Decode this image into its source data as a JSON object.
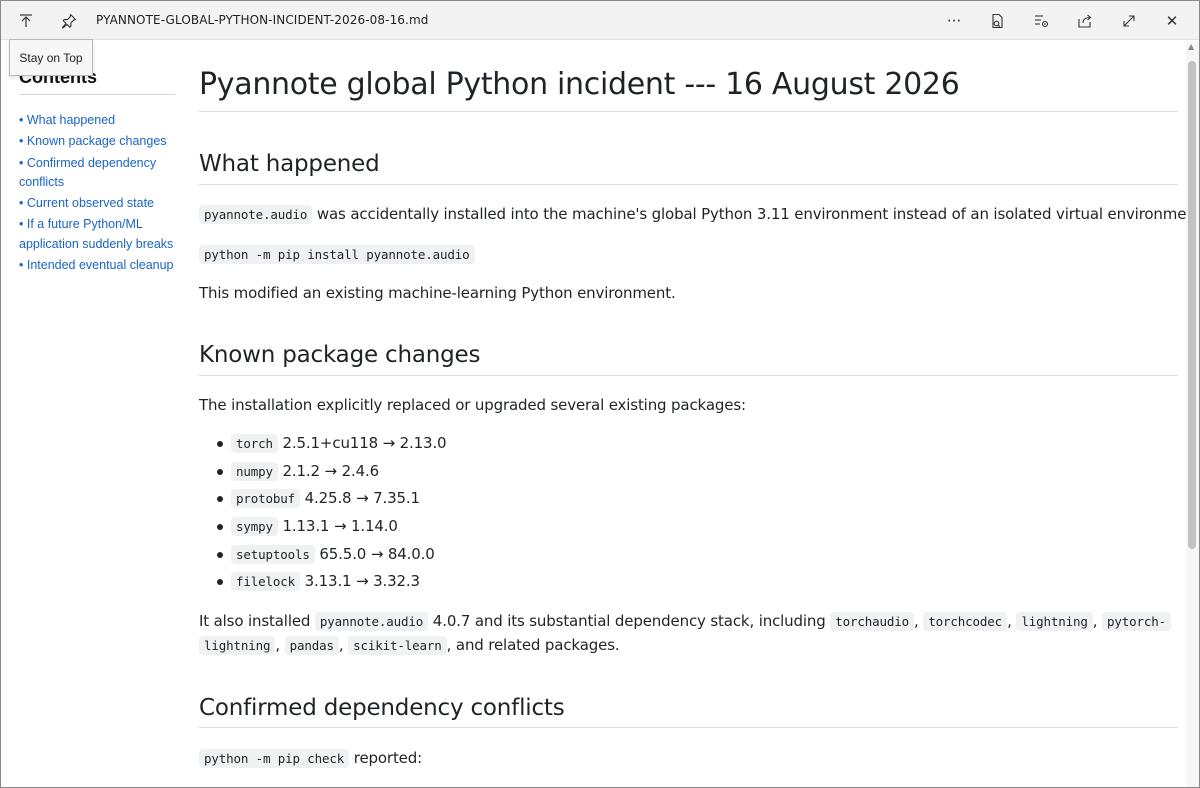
{
  "window": {
    "title": "PYANNOTE-GLOBAL-PYTHON-INCIDENT-2026-08-16.md",
    "tooltip": "Stay on Top",
    "more_label": "···",
    "close_label": "✕"
  },
  "toc": {
    "title": "Contents",
    "items": [
      {
        "label": "• What happened"
      },
      {
        "label": "• Known package changes"
      },
      {
        "label": "• Confirmed dependency conflicts"
      },
      {
        "label": "• Current observed state"
      },
      {
        "label": "• If a future Python/ML application suddenly breaks"
      },
      {
        "label": "• Intended eventual cleanup"
      }
    ]
  },
  "doc": {
    "h1": "Pyannote global Python incident --- 16 August 2026",
    "what_happened": {
      "heading": "What happened",
      "p1_code": "pyannote.audio",
      "p1_text": " was accidentally installed into the machine's global Python 3.11 environment instead of an isolated virtual environment:",
      "command": "python -m pip install pyannote.audio",
      "p2": "This modified an existing machine-learning Python environment."
    },
    "known_changes": {
      "heading": "Known package changes",
      "intro": "The installation explicitly replaced or upgraded several existing packages:",
      "packages": [
        {
          "name": "torch",
          "change": "2.5.1+cu118 → 2.13.0"
        },
        {
          "name": "numpy",
          "change": "2.1.2 → 2.4.6"
        },
        {
          "name": "protobuf",
          "change": "4.25.8 → 7.35.1"
        },
        {
          "name": "sympy",
          "change": "1.13.1 → 1.14.0"
        },
        {
          "name": "setuptools",
          "change": "65.5.0 → 84.0.0"
        },
        {
          "name": "filelock",
          "change": "3.13.1 → 3.32.3"
        }
      ],
      "also_1": "It also installed ",
      "also_code1": "pyannote.audio",
      "also_2": " 4.0.7 and its substantial dependency stack, including ",
      "also_code2": "torchaudio",
      "also_code3": "torchcodec",
      "also_code4": "lightning",
      "also_code5a": "pytorch-",
      "also_code5b": "lightning",
      "also_code6": "pandas",
      "also_code7": "scikit-learn",
      "also_end": ", and related packages."
    },
    "conflicts": {
      "heading": "Confirmed dependency conflicts",
      "check_code": "python -m pip check",
      "check_text": " reported:"
    }
  }
}
